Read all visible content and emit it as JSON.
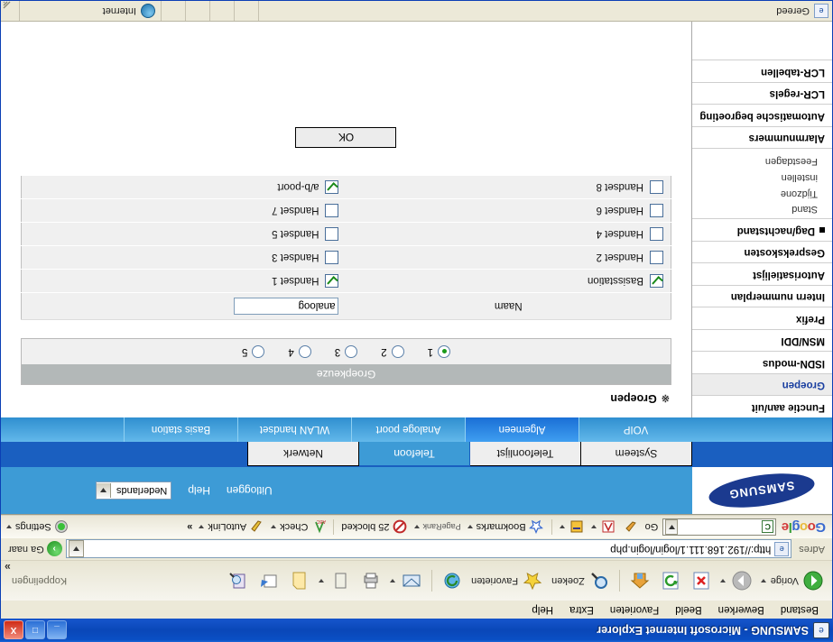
{
  "window": {
    "title": "SAMSUNG - Microsoft Internet Explorer",
    "minimize_label": "_",
    "maximize_label": "□",
    "close_label": "X"
  },
  "menubar": [
    "Bestand",
    "Bewerken",
    "Beeld",
    "Favorieten",
    "Extra",
    "Help"
  ],
  "toolbar": {
    "back_label": "Vorige",
    "forward_label": "",
    "stop_label": "",
    "refresh_label": "",
    "home_label": "",
    "search_label": "Zoeken",
    "favorites_label": "Favorieten",
    "history_label": "",
    "mail_label": "",
    "print_label": "",
    "edit_label": "",
    "discuss_label": "",
    "messenger_label": "",
    "research_label": "",
    "links_label": "Koppelingen",
    "overflow_label": "»"
  },
  "address": {
    "label": "Adres",
    "url": "http://192.168.111.1/login/login.php",
    "go_label": "Ga naar"
  },
  "google_toolbar": {
    "logo": "Google",
    "search_value": "",
    "go_label": "Go",
    "bookmarks_label": "Bookmarks",
    "pagerank_label": "PageRank",
    "blocked_label": "25 blocked",
    "check_label": "Check",
    "autolink_label": "AutoLink",
    "settings_label": "Settings",
    "overflow_label": "»"
  },
  "page_header": {
    "logo": "SAMSUNG",
    "logout_label": "Uitloggen",
    "help_label": "Help",
    "language_selected": "Nederlands"
  },
  "tabs_primary": [
    {
      "label": "Systeem",
      "active": false
    },
    {
      "label": "Telefoonlijst",
      "active": false
    },
    {
      "label": "Telefoon",
      "active": true
    },
    {
      "label": "Netwerk",
      "active": false
    }
  ],
  "tabs_secondary": [
    {
      "label": "VOIP",
      "active": false
    },
    {
      "label": "Algemeen",
      "active": true
    },
    {
      "label": "Analoge poort",
      "active": false
    },
    {
      "label": "WLAN handset",
      "active": false
    },
    {
      "label": "Basis station",
      "active": false
    }
  ],
  "sidebar": {
    "items": [
      {
        "label": "Functie aan/uit",
        "current": false,
        "parent": false
      },
      {
        "label": "Groepen",
        "current": true,
        "parent": false
      },
      {
        "label": "ISDN-modus",
        "current": false,
        "parent": false
      },
      {
        "label": "MSN/DDI",
        "current": false,
        "parent": false
      },
      {
        "label": "Prefix",
        "current": false,
        "parent": false
      },
      {
        "label": "Intern nummerplan",
        "current": false,
        "parent": false
      },
      {
        "label": "Autorisatielijst",
        "current": false,
        "parent": false
      },
      {
        "label": "Gesprekskosten",
        "current": false,
        "parent": false
      },
      {
        "label": "Dag/nachtstand",
        "current": false,
        "parent": true
      }
    ],
    "subitems": [
      "Stand",
      "Tijdzone",
      "instellen",
      "Feestdagen"
    ],
    "items_after": [
      {
        "label": "Alarmnummers",
        "current": false,
        "parent": false
      },
      {
        "label": "Automatische begroeting",
        "current": false,
        "parent": false
      },
      {
        "label": "LCR-regels",
        "current": false,
        "parent": false
      },
      {
        "label": "LCR-tabellen",
        "current": false,
        "parent": false
      }
    ]
  },
  "main": {
    "page_title": "Groepen",
    "page_title_mark": "※",
    "group_panel_header": "Groepkeuze",
    "group_options": [
      {
        "label": "1",
        "selected": true
      },
      {
        "label": "2",
        "selected": false
      },
      {
        "label": "3",
        "selected": false
      },
      {
        "label": "4",
        "selected": false
      },
      {
        "label": "5",
        "selected": false
      }
    ],
    "name_label": "Naam",
    "name_value": "analoog",
    "members": [
      {
        "left_label": "Basisstation",
        "left_checked": true,
        "right_label": "Handset 1",
        "right_checked": true
      },
      {
        "left_label": "Handset 2",
        "left_checked": false,
        "right_label": "Handset 3",
        "right_checked": false
      },
      {
        "left_label": "Handset 4",
        "left_checked": false,
        "right_label": "Handset 5",
        "right_checked": false
      },
      {
        "left_label": "Handset 6",
        "left_checked": false,
        "right_label": "Handset 7",
        "right_checked": false
      },
      {
        "left_label": "Handset 8",
        "left_checked": false,
        "right_label": "a/b-poort",
        "right_checked": true
      }
    ],
    "ok_label": "OK"
  },
  "statusbar": {
    "status_text": "Gereed",
    "zone_text": "Internet"
  },
  "colors": {
    "accent": "#3d9bd6",
    "tab_active": "#1a6fd6",
    "title_blue": "#0a47b8",
    "chrome": "#ece9d8"
  }
}
